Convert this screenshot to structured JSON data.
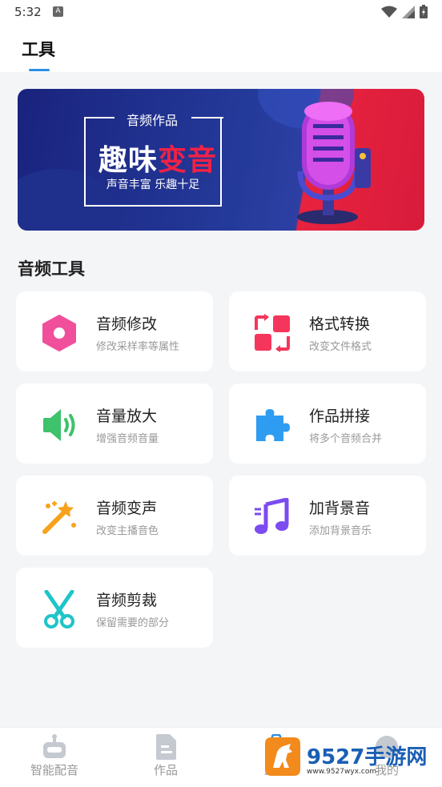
{
  "status_bar": {
    "time": "5:32",
    "notification": "A"
  },
  "header": {
    "title": "工具"
  },
  "banner": {
    "small": "音频作品",
    "big_white": "趣味",
    "big_red": "变音",
    "sub": "声音丰富 乐趣十足"
  },
  "section": {
    "title": "音频工具"
  },
  "tools": [
    {
      "title": "音频修改",
      "desc": "修改采样率等属性",
      "icon": "hexagon-icon",
      "color": "#f0509b"
    },
    {
      "title": "格式转换",
      "desc": "改变文件格式",
      "icon": "convert-icon",
      "color": "#f5365c"
    },
    {
      "title": "音量放大",
      "desc": "增强音频音量",
      "icon": "speaker-icon",
      "color": "#3ec26b"
    },
    {
      "title": "作品拼接",
      "desc": "将多个音频合并",
      "icon": "puzzle-icon",
      "color": "#2e9cf0"
    },
    {
      "title": "音频变声",
      "desc": "改变主播音色",
      "icon": "magic-wand-icon",
      "color": "#f7a21b"
    },
    {
      "title": "加背景音",
      "desc": "添加背景音乐",
      "icon": "music-note-icon",
      "color": "#7b4cf0"
    },
    {
      "title": "音频剪裁",
      "desc": "保留需要的部分",
      "icon": "scissors-icon",
      "color": "#1ec5c9"
    }
  ],
  "bottom_nav": [
    {
      "label": "智能配音",
      "icon": "robot-icon"
    },
    {
      "label": "作品",
      "icon": "document-icon"
    },
    {
      "label": "工具",
      "icon": "toolbox-icon"
    },
    {
      "label": "我的",
      "icon": "profile-icon"
    }
  ],
  "watermark": {
    "text": "9527手游网",
    "url": "www.9527wyx.com"
  }
}
